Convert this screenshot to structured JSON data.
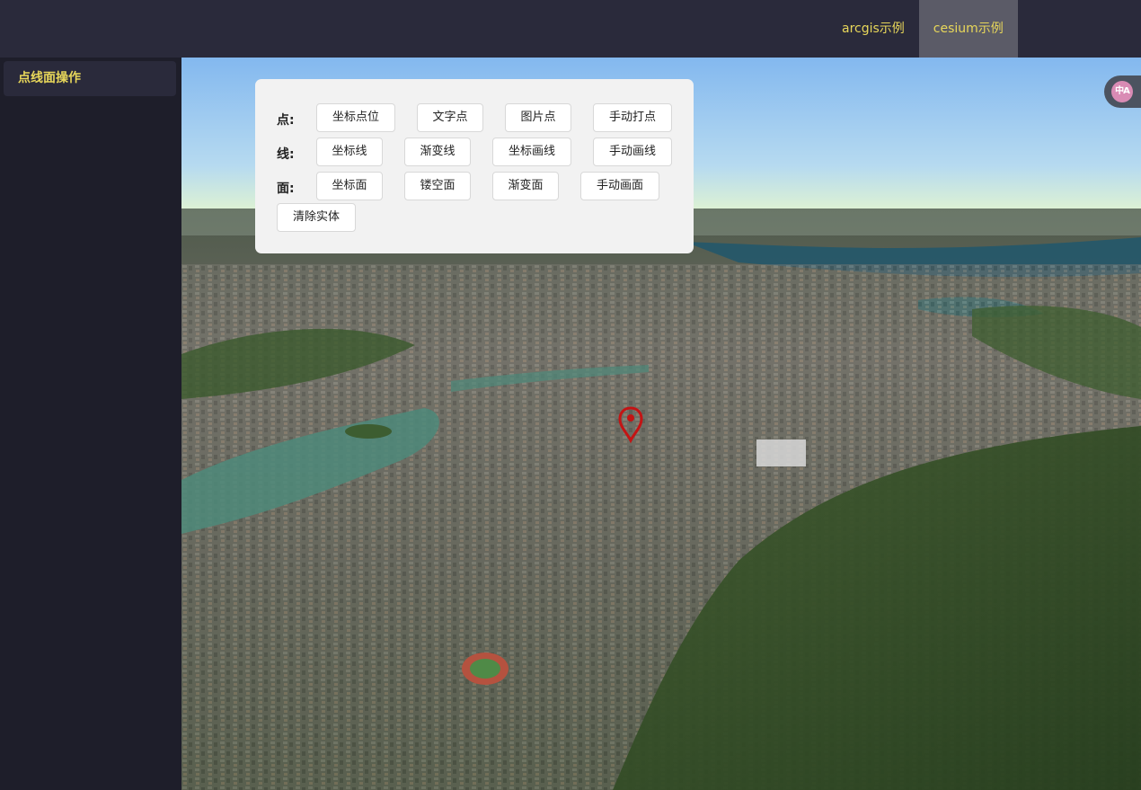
{
  "header": {
    "nav": [
      {
        "label": "arcgis示例",
        "active": false
      },
      {
        "label": "cesium示例",
        "active": true
      }
    ],
    "accent_color": "#e8d75a"
  },
  "sidebar": {
    "items": [
      {
        "label": "点线面操作",
        "active": true
      }
    ]
  },
  "toolbar": {
    "point": {
      "label": "点:",
      "buttons": [
        "坐标点位",
        "文字点",
        "图片点",
        "手动打点"
      ]
    },
    "line": {
      "label": "线:",
      "buttons": [
        "坐标线",
        "渐变线",
        "坐标画线",
        "手动画线"
      ]
    },
    "polygon": {
      "label": "面:",
      "buttons": [
        "坐标面",
        "镂空面",
        "渐变面",
        "手动画面"
      ]
    },
    "clear_label": "清除实体"
  },
  "translate_widget": {
    "icon": "translate-icon",
    "glyph": "中A"
  },
  "map": {
    "marker_icon": "map-pin-icon",
    "marker_color": "#c41414"
  }
}
